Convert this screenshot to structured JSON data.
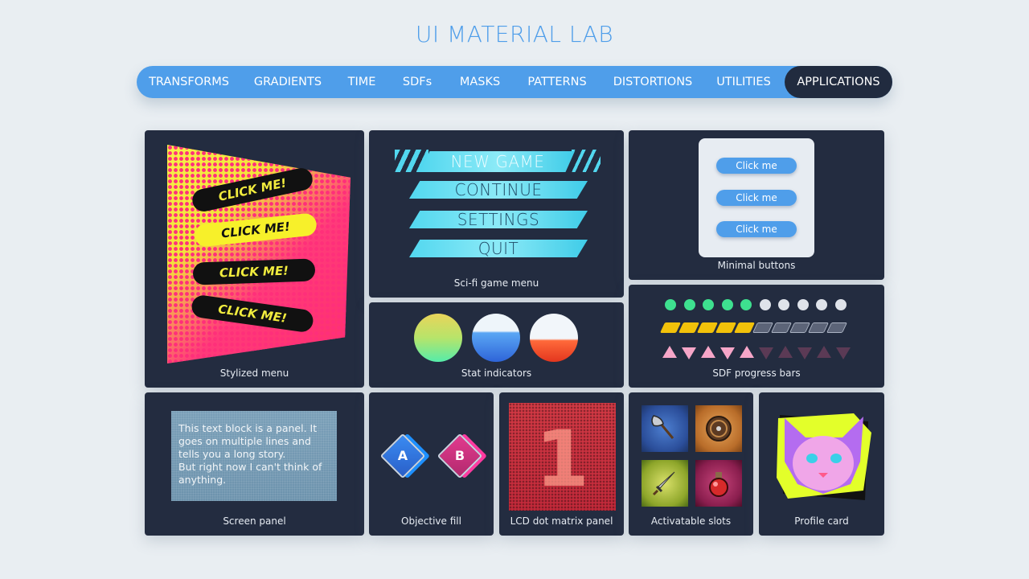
{
  "header": {
    "title": "UI MATERIAL LAB"
  },
  "nav": {
    "tabs": [
      {
        "label": "TRANSFORMS",
        "active": false
      },
      {
        "label": "GRADIENTS",
        "active": false
      },
      {
        "label": "TIME",
        "active": false
      },
      {
        "label": "SDFs",
        "active": false
      },
      {
        "label": "MASKS",
        "active": false
      },
      {
        "label": "PATTERNS",
        "active": false
      },
      {
        "label": "DISTORTIONS",
        "active": false
      },
      {
        "label": "UTILITIES",
        "active": false
      },
      {
        "label": "APPLICATIONS",
        "active": true
      }
    ]
  },
  "colors": {
    "accent": "#4f9eea",
    "card_bg": "#232c40",
    "page_bg": "#e9eef2"
  },
  "cards": {
    "stylized_menu": {
      "label": "Stylized menu",
      "buttons": [
        "CLICK ME!",
        "CLICK ME!",
        "CLICK ME!",
        "CLICK ME!"
      ]
    },
    "scifi_menu": {
      "label": "Sci-fi game menu",
      "buttons": [
        "NEW GAME",
        "CONTINUE",
        "SETTINGS",
        "QUIT"
      ]
    },
    "minimal_buttons": {
      "label": "Minimal buttons",
      "buttons": [
        "Click me",
        "Click me",
        "Click me"
      ]
    },
    "stat_indicators": {
      "label": "Stat indicators",
      "fill_levels": [
        0.5,
        0.6,
        0.45
      ]
    },
    "sdf_progress": {
      "label": "SDF progress bars",
      "dots": {
        "filled": 5,
        "total": 10
      },
      "bars": {
        "filled": 5,
        "total": 10
      },
      "triangles": {
        "filled": 5,
        "total": 10
      }
    },
    "screen_panel": {
      "label": "Screen panel",
      "text_line1": "This text block is a panel. It goes on multiple lines and tells you a long story.",
      "text_line2": "But right now I can't think of anything."
    },
    "objective_fill": {
      "label": "Objective fill",
      "letters": [
        "A",
        "B"
      ]
    },
    "lcd_panel": {
      "label": "LCD dot matrix panel",
      "digit": "1"
    },
    "slots": {
      "label": "Activatable slots",
      "icons": [
        "axe-icon",
        "shield-icon",
        "dagger-icon",
        "potion-icon"
      ]
    },
    "profile_card": {
      "label": "Profile card"
    }
  }
}
